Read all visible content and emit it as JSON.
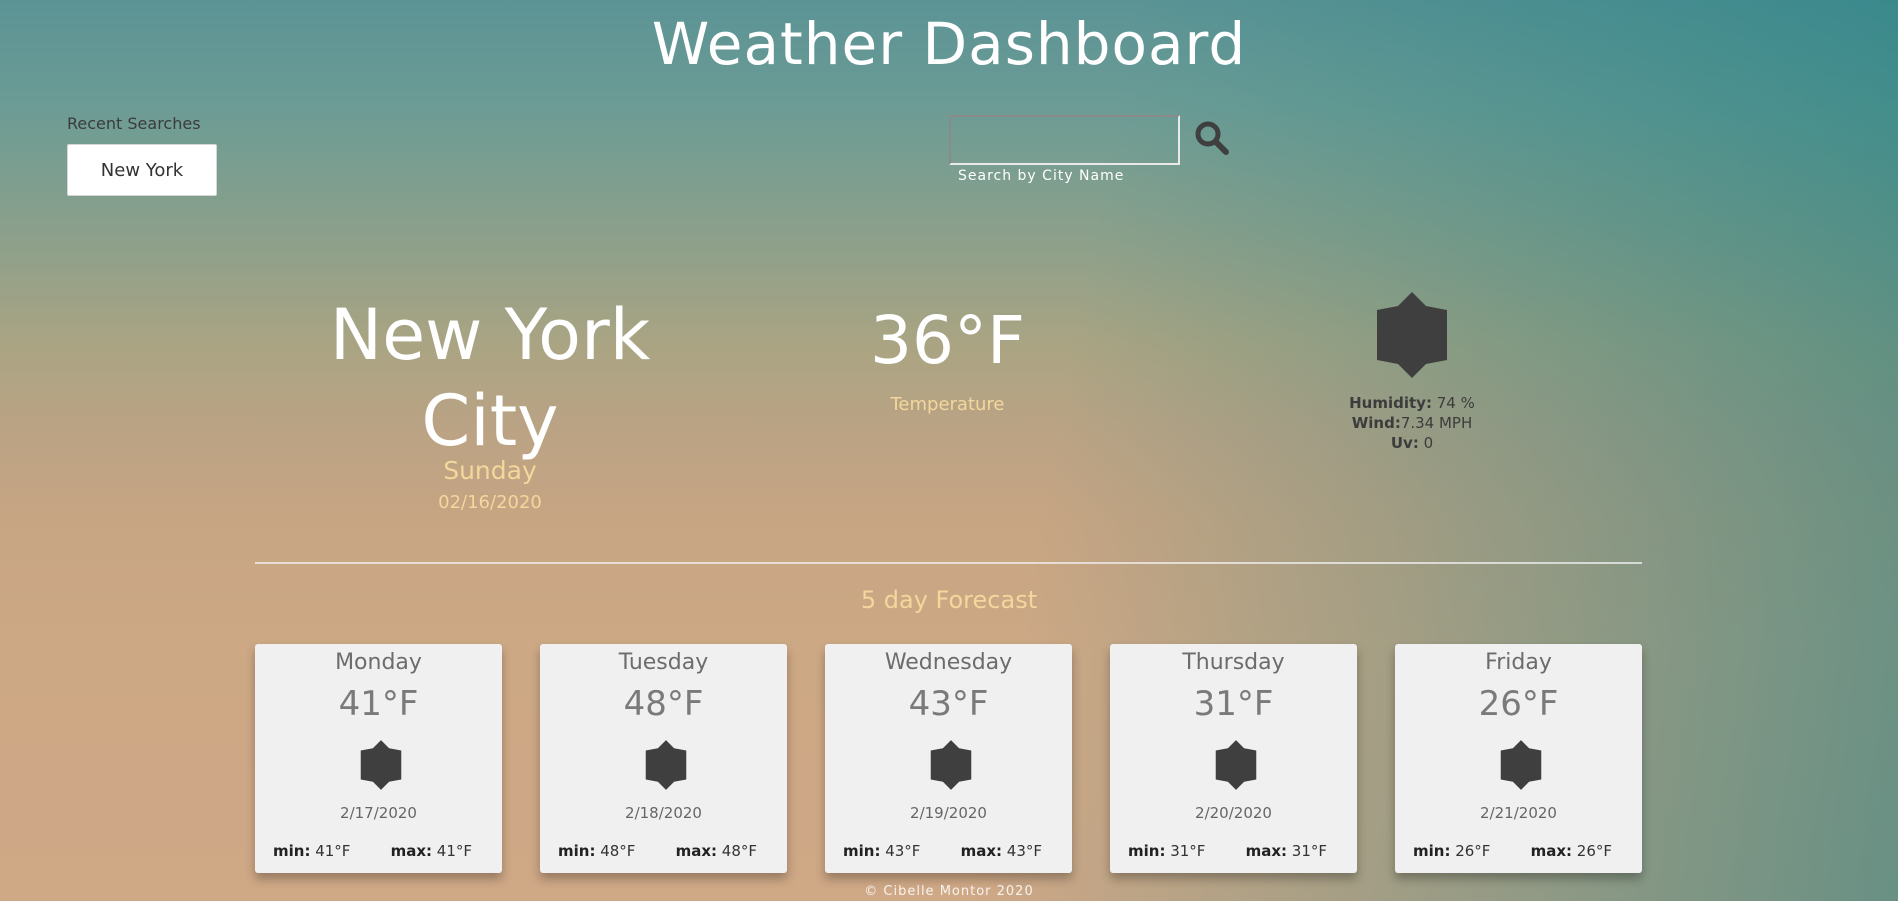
{
  "header": {
    "title": "Weather Dashboard"
  },
  "recent": {
    "label": "Recent Searches",
    "items": [
      "New York"
    ]
  },
  "search": {
    "value": "",
    "placeholder": "",
    "hint": "Search by City Name",
    "icon": "search-icon"
  },
  "current": {
    "city": "New York City",
    "day": "Sunday",
    "date": "02/16/2020",
    "temperature": "36°F",
    "temperature_label": "Temperature",
    "icon": "sun-icon",
    "humidity_label": "Humidity:",
    "humidity_value": " 74 %",
    "wind_label": "Wind:",
    "wind_value": "7.34 MPH",
    "uv_label": "Uv:",
    "uv_value": " 0"
  },
  "forecast": {
    "title": "5 day Forecast",
    "min_label": "min:",
    "max_label": "max:",
    "days": [
      {
        "day": "Monday",
        "temp": "41°F",
        "date": "2/17/2020",
        "min": " 41°F",
        "max": " 41°F",
        "icon": "sun-icon"
      },
      {
        "day": "Tuesday",
        "temp": "48°F",
        "date": "2/18/2020",
        "min": " 48°F",
        "max": " 48°F",
        "icon": "sun-icon"
      },
      {
        "day": "Wednesday",
        "temp": "43°F",
        "date": "2/19/2020",
        "min": " 43°F",
        "max": " 43°F",
        "icon": "sun-icon"
      },
      {
        "day": "Thursday",
        "temp": "31°F",
        "date": "2/20/2020",
        "min": " 31°F",
        "max": " 31°F",
        "icon": "sun-icon"
      },
      {
        "day": "Friday",
        "temp": "26°F",
        "date": "2/21/2020",
        "min": " 26°F",
        "max": " 26°F",
        "icon": "sun-icon"
      }
    ]
  },
  "footer": {
    "text": "© Cibelle Montor 2020"
  },
  "colors": {
    "accent_text": "#f4d79c",
    "title_text": "#ffffff",
    "icon": "#3f3f3f",
    "card_bg": "#f0f0f0"
  }
}
